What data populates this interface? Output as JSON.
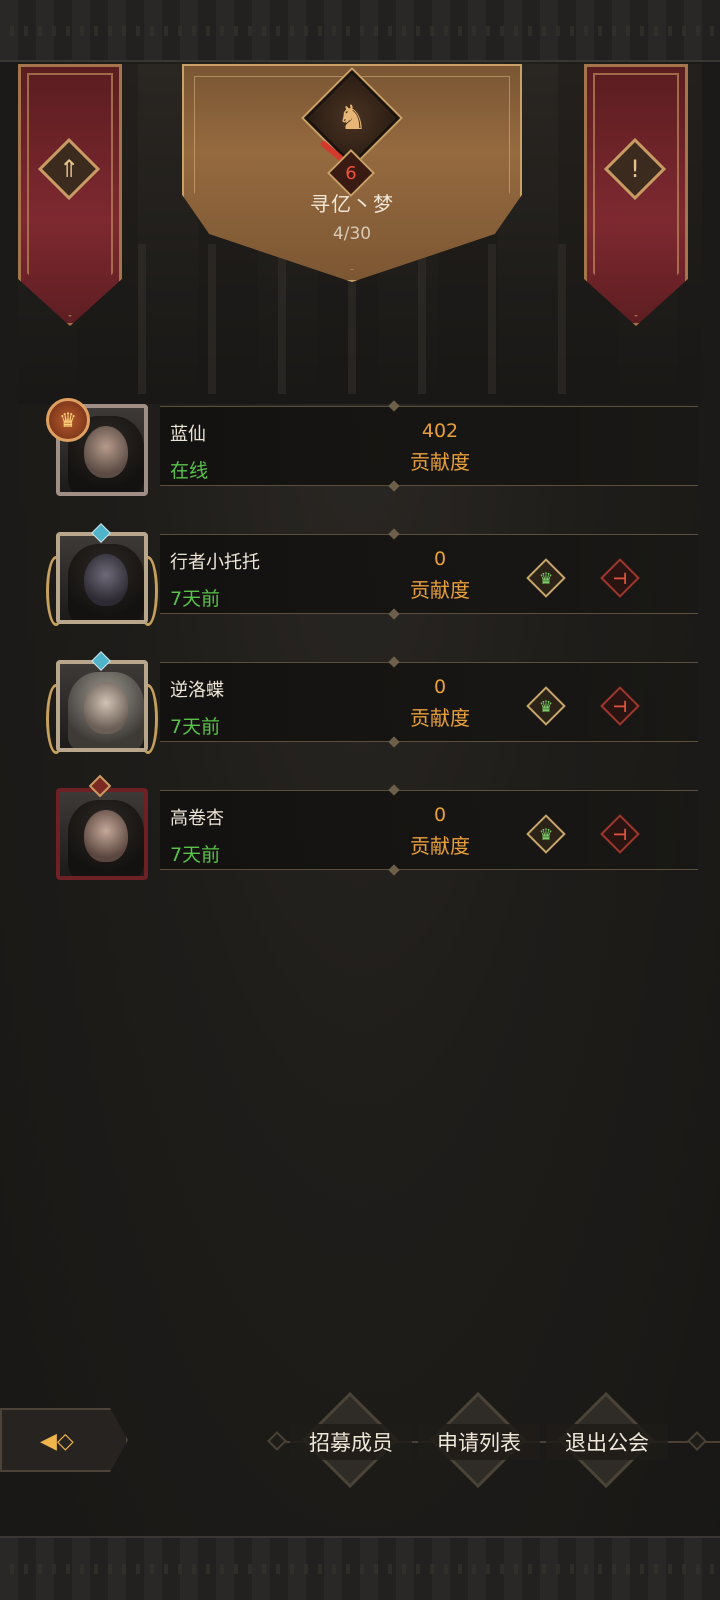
{
  "guild": {
    "name": "寻亿丶梦",
    "member_count": "4/30",
    "level": "6"
  },
  "members": [
    {
      "name": "蓝仙",
      "status": "在线",
      "contribution": "402",
      "contribution_label": "贡献度",
      "frame": "pink",
      "is_leader": true
    },
    {
      "name": "行者小托托",
      "status": "7天前",
      "contribution": "0",
      "contribution_label": "贡献度",
      "frame": "gold",
      "is_leader": false
    },
    {
      "name": "逆洛蝶",
      "status": "7天前",
      "contribution": "0",
      "contribution_label": "贡献度",
      "frame": "gold",
      "is_leader": false
    },
    {
      "name": "高卷杏",
      "status": "7天前",
      "contribution": "0",
      "contribution_label": "贡献度",
      "frame": "red",
      "is_leader": false
    }
  ],
  "toolbar": {
    "recruit_label": "招募成员",
    "applications_label": "申请列表",
    "leave_label": "退出公会"
  },
  "icons": {
    "banner_left": "guild-rank-icon",
    "banner_right": "guild-info-icon",
    "crest": "guild-crest-icon",
    "promote": "promote-member-icon",
    "kick": "kick-member-icon",
    "back": "back-arrow-icon"
  },
  "colors": {
    "online": "#58c24a",
    "offline": "#58c24a",
    "contribution": "#e9a03a",
    "banner": "#7e2930",
    "level": "#f2523d"
  }
}
